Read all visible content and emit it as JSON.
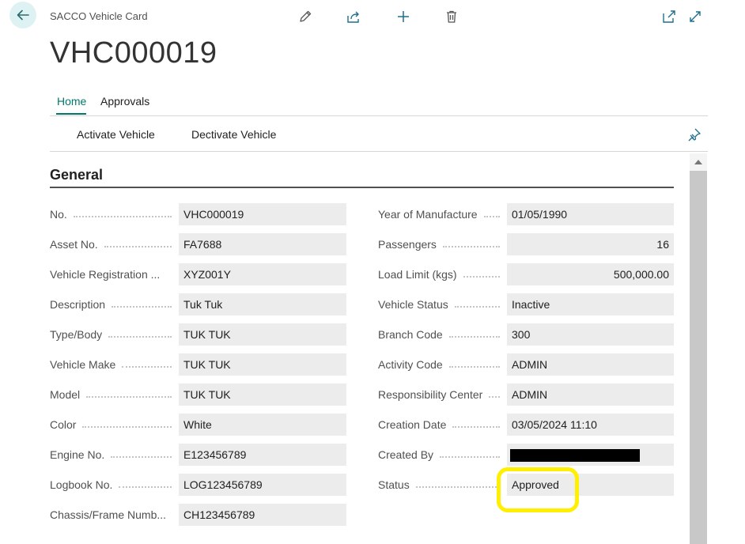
{
  "header": {
    "caption": "SACCO Vehicle Card",
    "title": "VHC000019"
  },
  "tabs": [
    {
      "label": "Home",
      "active": true
    },
    {
      "label": "Approvals",
      "active": false
    }
  ],
  "actions": [
    "Activate Vehicle",
    "Dectivate Vehicle"
  ],
  "section": {
    "title": "General"
  },
  "left_fields": [
    {
      "label": "No.",
      "value": "VHC000019"
    },
    {
      "label": "Asset No.",
      "value": "FA7688"
    },
    {
      "label": "Vehicle Registration ...",
      "value": "XYZ001Y"
    },
    {
      "label": "Description",
      "value": "Tuk Tuk"
    },
    {
      "label": "Type/Body",
      "value": "TUK TUK"
    },
    {
      "label": "Vehicle Make",
      "value": "TUK TUK"
    },
    {
      "label": "Model",
      "value": "TUK TUK"
    },
    {
      "label": "Color",
      "value": "White"
    },
    {
      "label": "Engine No.",
      "value": "E123456789"
    },
    {
      "label": "Logbook No.",
      "value": "LOG123456789"
    },
    {
      "label": "Chassis/Frame Numb...",
      "value": "CH123456789"
    }
  ],
  "right_fields": [
    {
      "label": "Year of Manufacture",
      "value": "01/05/1990"
    },
    {
      "label": "Passengers",
      "value": "16"
    },
    {
      "label": "Load Limit (kgs)",
      "value": "500,000.00"
    },
    {
      "label": "Vehicle Status",
      "value": "Inactive"
    },
    {
      "label": "Branch Code",
      "value": "300"
    },
    {
      "label": "Activity Code",
      "value": "ADMIN"
    },
    {
      "label": "Responsibility Center",
      "value": "ADMIN"
    },
    {
      "label": "Creation Date",
      "value": "03/05/2024 11:10"
    },
    {
      "label": "Created By",
      "value": ""
    },
    {
      "label": "Status",
      "value": "Approved"
    }
  ],
  "icons": {
    "back": "arrow-left-icon",
    "edit": "pencil-icon",
    "share": "share-icon",
    "new": "plus-icon",
    "delete": "trash-icon",
    "open_new_window": "open-in-new-window-icon",
    "expand": "expand-icon",
    "personalize": "pin-icon"
  },
  "colors": {
    "accent": "#00796b",
    "highlight": "#ffef00"
  }
}
